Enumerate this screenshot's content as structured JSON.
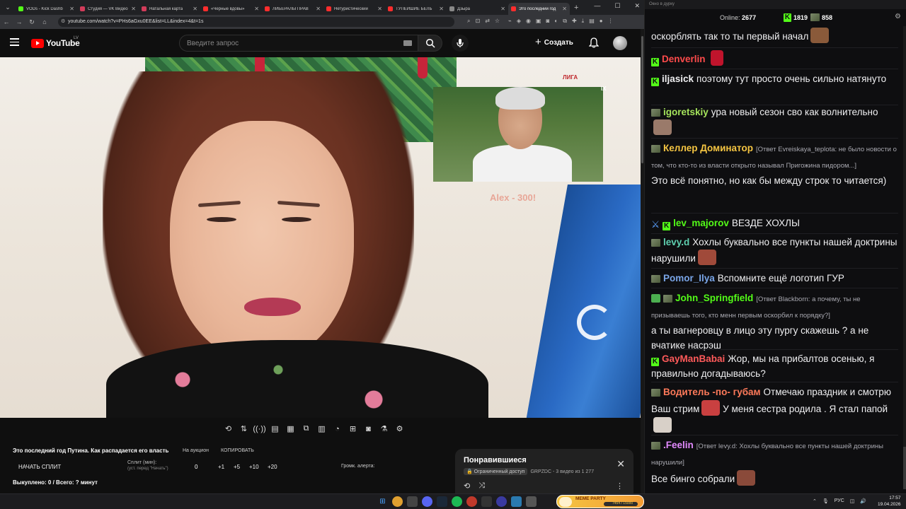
{
  "browser": {
    "tabs": [
      {
        "title": "VODs - Kick Dashb",
        "color": "#53fc18"
      },
      {
        "title": "Студия — VK Видео",
        "color": "#d23c5a"
      },
      {
        "title": "Натальная карта",
        "color": "#d23c5a"
      },
      {
        "title": "«Черные вдовы»",
        "color": "#ff2d2d"
      },
      {
        "title": "ЛИБЕРАЛЫ ПРАВ",
        "color": "#ff2d2d"
      },
      {
        "title": "Нетуристический",
        "color": "#ff2d2d"
      },
      {
        "title": "ТУПЕЙШИЕ БЕЛЬ",
        "color": "#ff2d2d"
      },
      {
        "title": "Дзыра",
        "color": "#888888"
      },
      {
        "title": "Это последний год",
        "color": "#ff2d2d",
        "active": true
      }
    ],
    "url": "youtube.com/watch?v=PHs6aGxu0EE&list=LL&index=4&t=1s"
  },
  "youtube": {
    "logo": "YouTube",
    "country": "LV",
    "search_placeholder": "Введите запрос",
    "create_label": "Создать",
    "video": {
      "watermark": "ЛИГА",
      "pip_caption": "Alex - 300!"
    },
    "tools": {
      "title": "Это последний год Путина. Как распадается его власть",
      "auction": "На аукцион",
      "copy": "КОПИРОВАТЬ",
      "split_button": "НАЧАТЬ СПЛИТ",
      "split_min_label": "Сплит (мин):",
      "split_min_sub": "(уст. перед \"Начать\")",
      "split_value": "0",
      "increments": [
        "+1",
        "+5",
        "+10",
        "+20"
      ],
      "alert_volume": "Громк. алерта:",
      "bought": "Выкуплено: 0 / Всего: ? минут"
    },
    "liked": {
      "title": "Понравившиеся",
      "access": "Ограниченный доступ",
      "meta": "GRPZDC - 3 видео из 1 277"
    }
  },
  "chat": {
    "window_title": "Окно в дурку",
    "online_label": "Online:",
    "online_count": "2677",
    "kick_count": "1819",
    "other_count": "858",
    "messages": [
      {
        "user": "",
        "text": "оскорблять так то ты первый начал",
        "color": "#ffffff"
      },
      {
        "user": "Denverlin",
        "text": "",
        "color": "#ff4b4b"
      },
      {
        "user": "iljasick",
        "text": "поэтому тут просто очень сильно натянуто",
        "color": "#ffffff"
      },
      {
        "user": "igoretskiy",
        "text": "ура новый сезон сво как волнительно",
        "color": "#a4e35b"
      },
      {
        "user": "Келлер Доминатор",
        "reply": "[Ответ Evreiskaya_teplota: не было новости о том, что кто-то из власти открыто называл Пригожина пидором...]",
        "text": "Это всё понятно, но как бы между строк то читается)",
        "color": "#f5c542"
      },
      {
        "user": "lev_majorov",
        "text": "ВЕЗДЕ ХОХЛЫ",
        "color": "#53fc18"
      },
      {
        "user": "levy.d",
        "text": "Хохлы буквально все пункты нашей доктрины нарушили",
        "color": "#5fd0b0"
      },
      {
        "user": "Pomor_Ilya",
        "text": "Вспомните ещё логотип ГУР",
        "color": "#7aa6e8"
      },
      {
        "user": "John_Springfield",
        "reply": "[Ответ Blackborn: а почему, ты не призываешь того, кто менн первым оскорбил к порядку?]",
        "text": "а ты вагнеровцу в лицо эту пургу скажешь ? а не вчатике насрэш",
        "color": "#53fc18"
      },
      {
        "user": "GayManBabai",
        "text": "Жор, мы на прибалтов осенью, я правильно догадываюсь?",
        "color": "#ff5a5a"
      },
      {
        "user": "Водитель -по- губам",
        "text1": "Отмечаю праздник и смотрю Ваш стрим",
        "text2": "У меня сестра родила . Я стал папой",
        "color": "#ff7a5a"
      },
      {
        "user": ".Feelin",
        "reply": "[Ответ levy.d: Хохлы буквально все пункты нашей доктрины нарушили]",
        "text": "Все бинго собрали",
        "color": "#e38bff"
      }
    ]
  },
  "taskbar": {
    "meme_party": "MEME PARTY",
    "meme_progress": "7454 / 15000",
    "lang": "РУС",
    "time": "17:57",
    "date": "19.04.2026"
  }
}
